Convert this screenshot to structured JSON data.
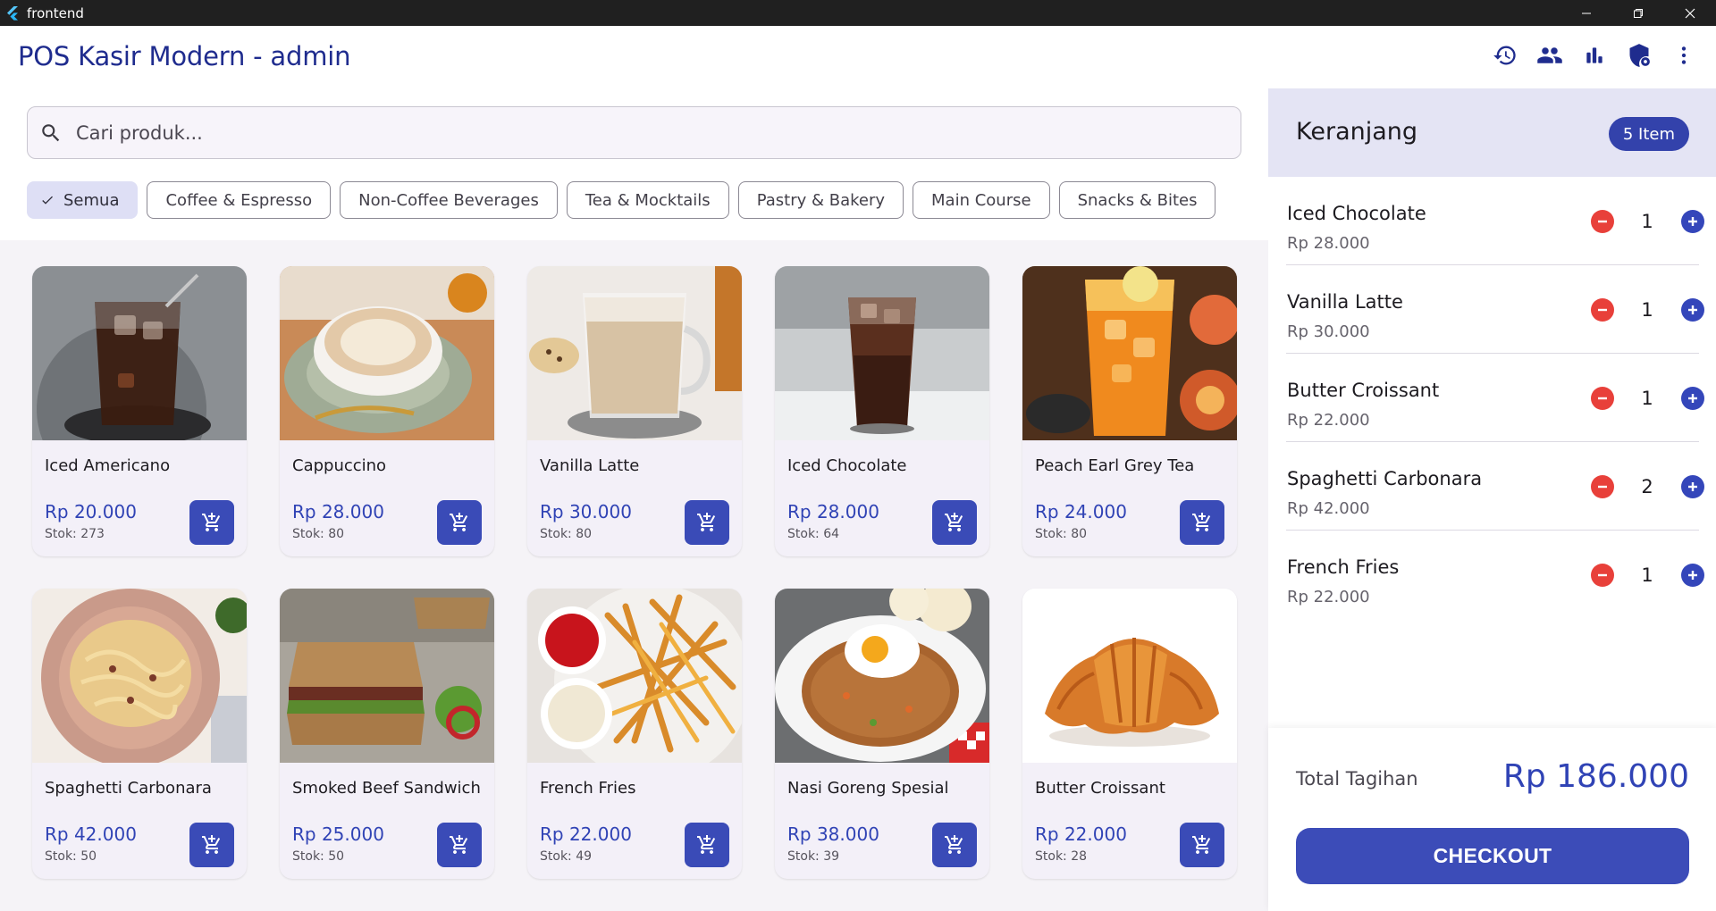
{
  "window": {
    "app_name": "frontend"
  },
  "appbar": {
    "title": "POS Kasir Modern - admin",
    "actions": [
      "history-icon",
      "users-icon",
      "bar-chart-icon",
      "shield-settings-icon",
      "more-vertical-icon"
    ]
  },
  "search": {
    "placeholder": "Cari produk..."
  },
  "categories": [
    {
      "label": "Semua",
      "selected": true
    },
    {
      "label": "Coffee & Espresso",
      "selected": false
    },
    {
      "label": "Non-Coffee Beverages",
      "selected": false
    },
    {
      "label": "Tea & Mocktails",
      "selected": false
    },
    {
      "label": "Pastry & Bakery",
      "selected": false
    },
    {
      "label": "Main Course",
      "selected": false
    },
    {
      "label": "Snacks & Bites",
      "selected": false
    }
  ],
  "products": [
    {
      "name": "Iced Americano",
      "price": "Rp 20.000",
      "stock": "Stok: 273"
    },
    {
      "name": "Cappuccino",
      "price": "Rp 28.000",
      "stock": "Stok: 80"
    },
    {
      "name": "Vanilla Latte",
      "price": "Rp 30.000",
      "stock": "Stok: 80"
    },
    {
      "name": "Iced Chocolate",
      "price": "Rp 28.000",
      "stock": "Stok: 64"
    },
    {
      "name": "Peach Earl Grey Tea",
      "price": "Rp 24.000",
      "stock": "Stok: 80"
    },
    {
      "name": "Spaghetti Carbonara",
      "price": "Rp 42.000",
      "stock": "Stok: 50"
    },
    {
      "name": "Smoked Beef Sandwich",
      "price": "Rp 25.000",
      "stock": "Stok: 50"
    },
    {
      "name": "French Fries",
      "price": "Rp 22.000",
      "stock": "Stok: 49"
    },
    {
      "name": "Nasi Goreng Spesial",
      "price": "Rp 38.000",
      "stock": "Stok: 39"
    },
    {
      "name": "Butter Croissant",
      "price": "Rp 22.000",
      "stock": "Stok: 28"
    }
  ],
  "cart": {
    "title": "Keranjang",
    "badge": "5 Item",
    "items": [
      {
        "name": "Iced Chocolate",
        "price": "Rp 28.000",
        "qty": "1"
      },
      {
        "name": "Vanilla Latte",
        "price": "Rp 30.000",
        "qty": "1"
      },
      {
        "name": "Butter Croissant",
        "price": "Rp 22.000",
        "qty": "1"
      },
      {
        "name": "Spaghetti Carbonara",
        "price": "Rp 42.000",
        "qty": "2"
      },
      {
        "name": "French Fries",
        "price": "Rp 22.000",
        "qty": "1"
      }
    ],
    "total_label": "Total Tagihan",
    "total_value": "Rp 186.000",
    "checkout_label": "CHECKOUT"
  },
  "colors": {
    "primary": "#3a4bb7",
    "title": "#1f2c8e",
    "danger": "#e8403a",
    "chip_selected": "#dedff5"
  }
}
